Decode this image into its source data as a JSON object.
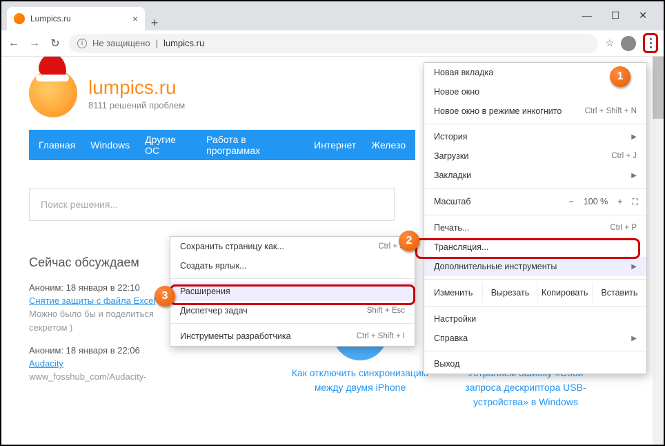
{
  "window": {
    "min": "—",
    "max": "☐",
    "close": "✕"
  },
  "tab": {
    "title": "Lumpics.ru",
    "new": "+"
  },
  "toolbar": {
    "security": "Не защищено",
    "url": "lumpics.ru"
  },
  "brand": {
    "name": "lumpics.ru",
    "tagline": "8111 решений проблем"
  },
  "nav": [
    "Главная",
    "Windows",
    "Другие ОС",
    "Работа в программах",
    "Интернет",
    "Железо"
  ],
  "search": {
    "placeholder": "Поиск решения..."
  },
  "discuss": {
    "title": "Сейчас обсуждаем",
    "posts": [
      {
        "meta": "Аноним: 18 января в 22:10",
        "link": "Снятие защиты с файла Excel",
        "body": "Можно было бы и поделиться секретом )"
      },
      {
        "meta": "Аноним: 18 января в 22:06",
        "link": "Audacity",
        "body": "www_fosshub_com/Audacity-"
      }
    ]
  },
  "cards": [
    "Как отключить синхронизацию между двумя iPhone",
    "Устраняем ошибку «Сбой запроса дескриптора USB-устройства» в Windows"
  ],
  "menu": {
    "new_tab": "Новая вкладка",
    "new_window": "Новое окно",
    "incognito": "Новое окно в режиме инкогнито",
    "incognito_sc": "Ctrl + Shift + N",
    "history": "История",
    "downloads": "Загрузки",
    "downloads_sc": "Ctrl + J",
    "bookmarks": "Закладки",
    "zoom_label": "Масштаб",
    "zoom_minus": "−",
    "zoom_val": "100 %",
    "zoom_plus": "+",
    "print": "Печать...",
    "print_sc": "Ctrl + P",
    "cast": "Трансляция...",
    "more_tools": "Дополнительные инструменты",
    "edit": "Изменить",
    "cut": "Вырезать",
    "copy": "Копировать",
    "paste": "Вставить",
    "settings": "Настройки",
    "help": "Справка",
    "exit": "Выход"
  },
  "submenu": {
    "save_page": "Сохранить страницу как...",
    "save_sc": "Ctrl + S",
    "shortcut": "Создать ярлык...",
    "extensions": "Расширения",
    "taskmgr": "Диспетчер задач",
    "taskmgr_sc": "Shift + Esc",
    "devtools": "Инструменты разработчика",
    "devtools_sc": "Ctrl + Shift + I"
  },
  "badges": {
    "b1": "1",
    "b2": "2",
    "b3": "3"
  }
}
